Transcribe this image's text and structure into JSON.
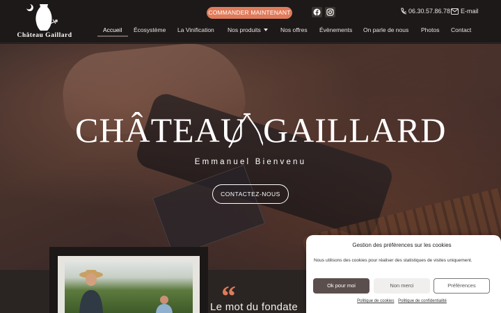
{
  "brand": {
    "logo_text": "Château Gaillard"
  },
  "header": {
    "order_button": "COMMANDER MAINTENANT",
    "phone": "06.30.57.86.78",
    "email_label": "E-mail",
    "social": [
      "facebook-icon",
      "instagram-icon"
    ]
  },
  "nav": {
    "items": [
      {
        "label": "Accueil",
        "active": true
      },
      {
        "label": "Écosystème"
      },
      {
        "label": "La Vinification"
      },
      {
        "label": "Nos produits",
        "dropdown": true
      },
      {
        "label": "Nos offres"
      },
      {
        "label": "Évènements"
      },
      {
        "label": "On parle de nous"
      },
      {
        "label": "Photos"
      },
      {
        "label": "Contact"
      }
    ]
  },
  "hero": {
    "title_left": "Château",
    "title_right": "Gaillard",
    "subtitle": "Emmanuel Bienvenu",
    "cta": "CONTACTEZ-NOUS"
  },
  "founder": {
    "quote_mark": "“",
    "title": "Le mot du fondate"
  },
  "cookie": {
    "title": "Gestion des préférences sur les cookies",
    "text": "Nous utilisons des cookies pour réaliser des statistiques de visites uniquement.",
    "accept": "Ok pour moi",
    "deny": "Non merci",
    "preferences": "Préférences",
    "link_cookies": "Politique de cookies",
    "link_privacy": "Politique de confidentialité"
  },
  "colors": {
    "accent": "#e07b5a",
    "header_bg": "#1c1918",
    "button_dark": "#5b4f4d"
  }
}
